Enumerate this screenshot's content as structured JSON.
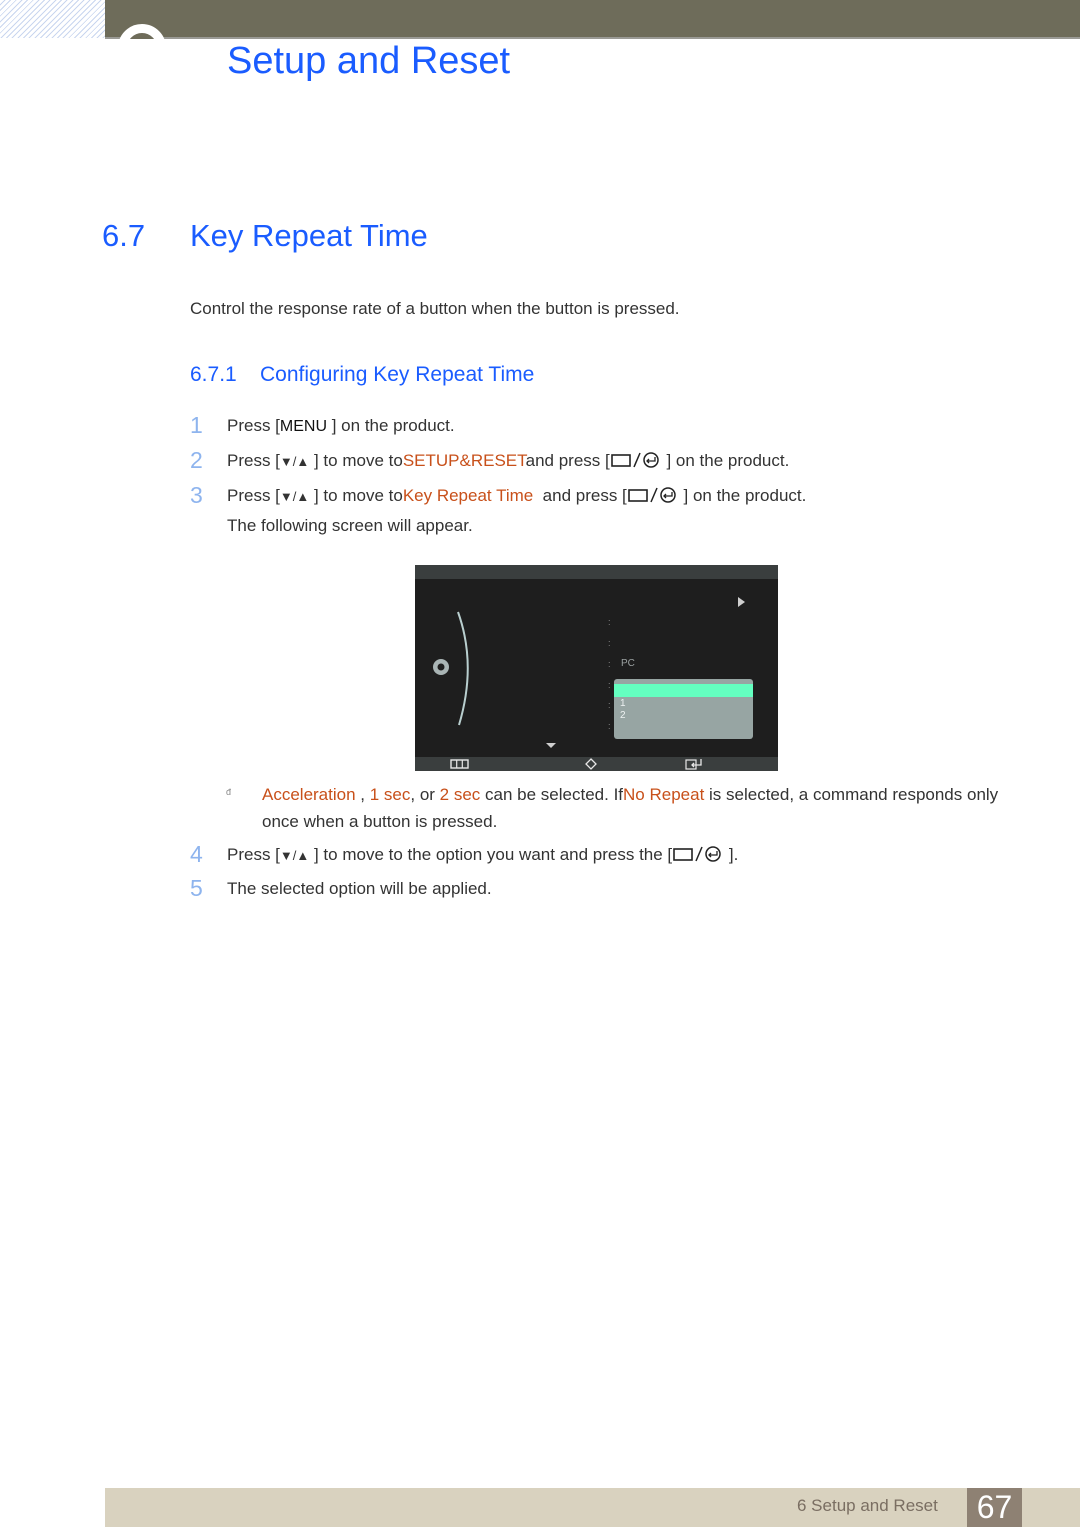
{
  "header": {
    "chapter_title": "Setup and Reset"
  },
  "section": {
    "number": "6.7",
    "title": "Key Repeat Time",
    "intro": "Control the response rate of a button when the button is pressed."
  },
  "subsection": {
    "number": "6.7.1",
    "title": "Configuring Key Repeat Time"
  },
  "steps": [
    {
      "num": "1",
      "pre": "Press [",
      "key": "MENU",
      "post": " ] on the product."
    },
    {
      "num": "2",
      "pre": "Press [",
      "key": "▼/▲",
      "mid1": " ] to move to",
      "target": "SETUP&RESET",
      "mid2": "and press [",
      "post": " ] on the product."
    },
    {
      "num": "3",
      "pre": "Press [",
      "key": "▼/▲",
      "mid1": " ] to move to",
      "target": "Key Repeat Time",
      "mid2": "  and press [",
      "post": " ] on the product.",
      "followup": "The following screen will appear."
    },
    {
      "num": "4",
      "pre": "Press [",
      "key": "▼/▲",
      "mid1": " ] to move to the option you want and press the [",
      "post": " ]."
    },
    {
      "num": "5",
      "text": "The selected option will be applied."
    }
  ],
  "osd": {
    "pc_value": "PC",
    "options": [
      "",
      "1",
      "2"
    ],
    "selected_index": 0,
    "icons": [
      "gear-icon",
      "triangle-right-icon",
      "triangle-down-icon",
      "menu-bars-icon",
      "up-down-icon",
      "enter-icon"
    ]
  },
  "note": {
    "opt1": "Acceleration",
    "sep1": " , ",
    "opt2": "1 sec",
    "sep2": ", or ",
    "opt3": "2 sec",
    "mid": " can be selected. If",
    "opt4": "No Repeat",
    "tail": " is selected, a command responds only once when a button is pressed."
  },
  "footer": {
    "label": "6 Setup and Reset",
    "page": "67"
  },
  "colors": {
    "heading_blue": "#1a5cff",
    "highlight_orange": "#c8501a",
    "osd_selection": "#64ffc0"
  }
}
